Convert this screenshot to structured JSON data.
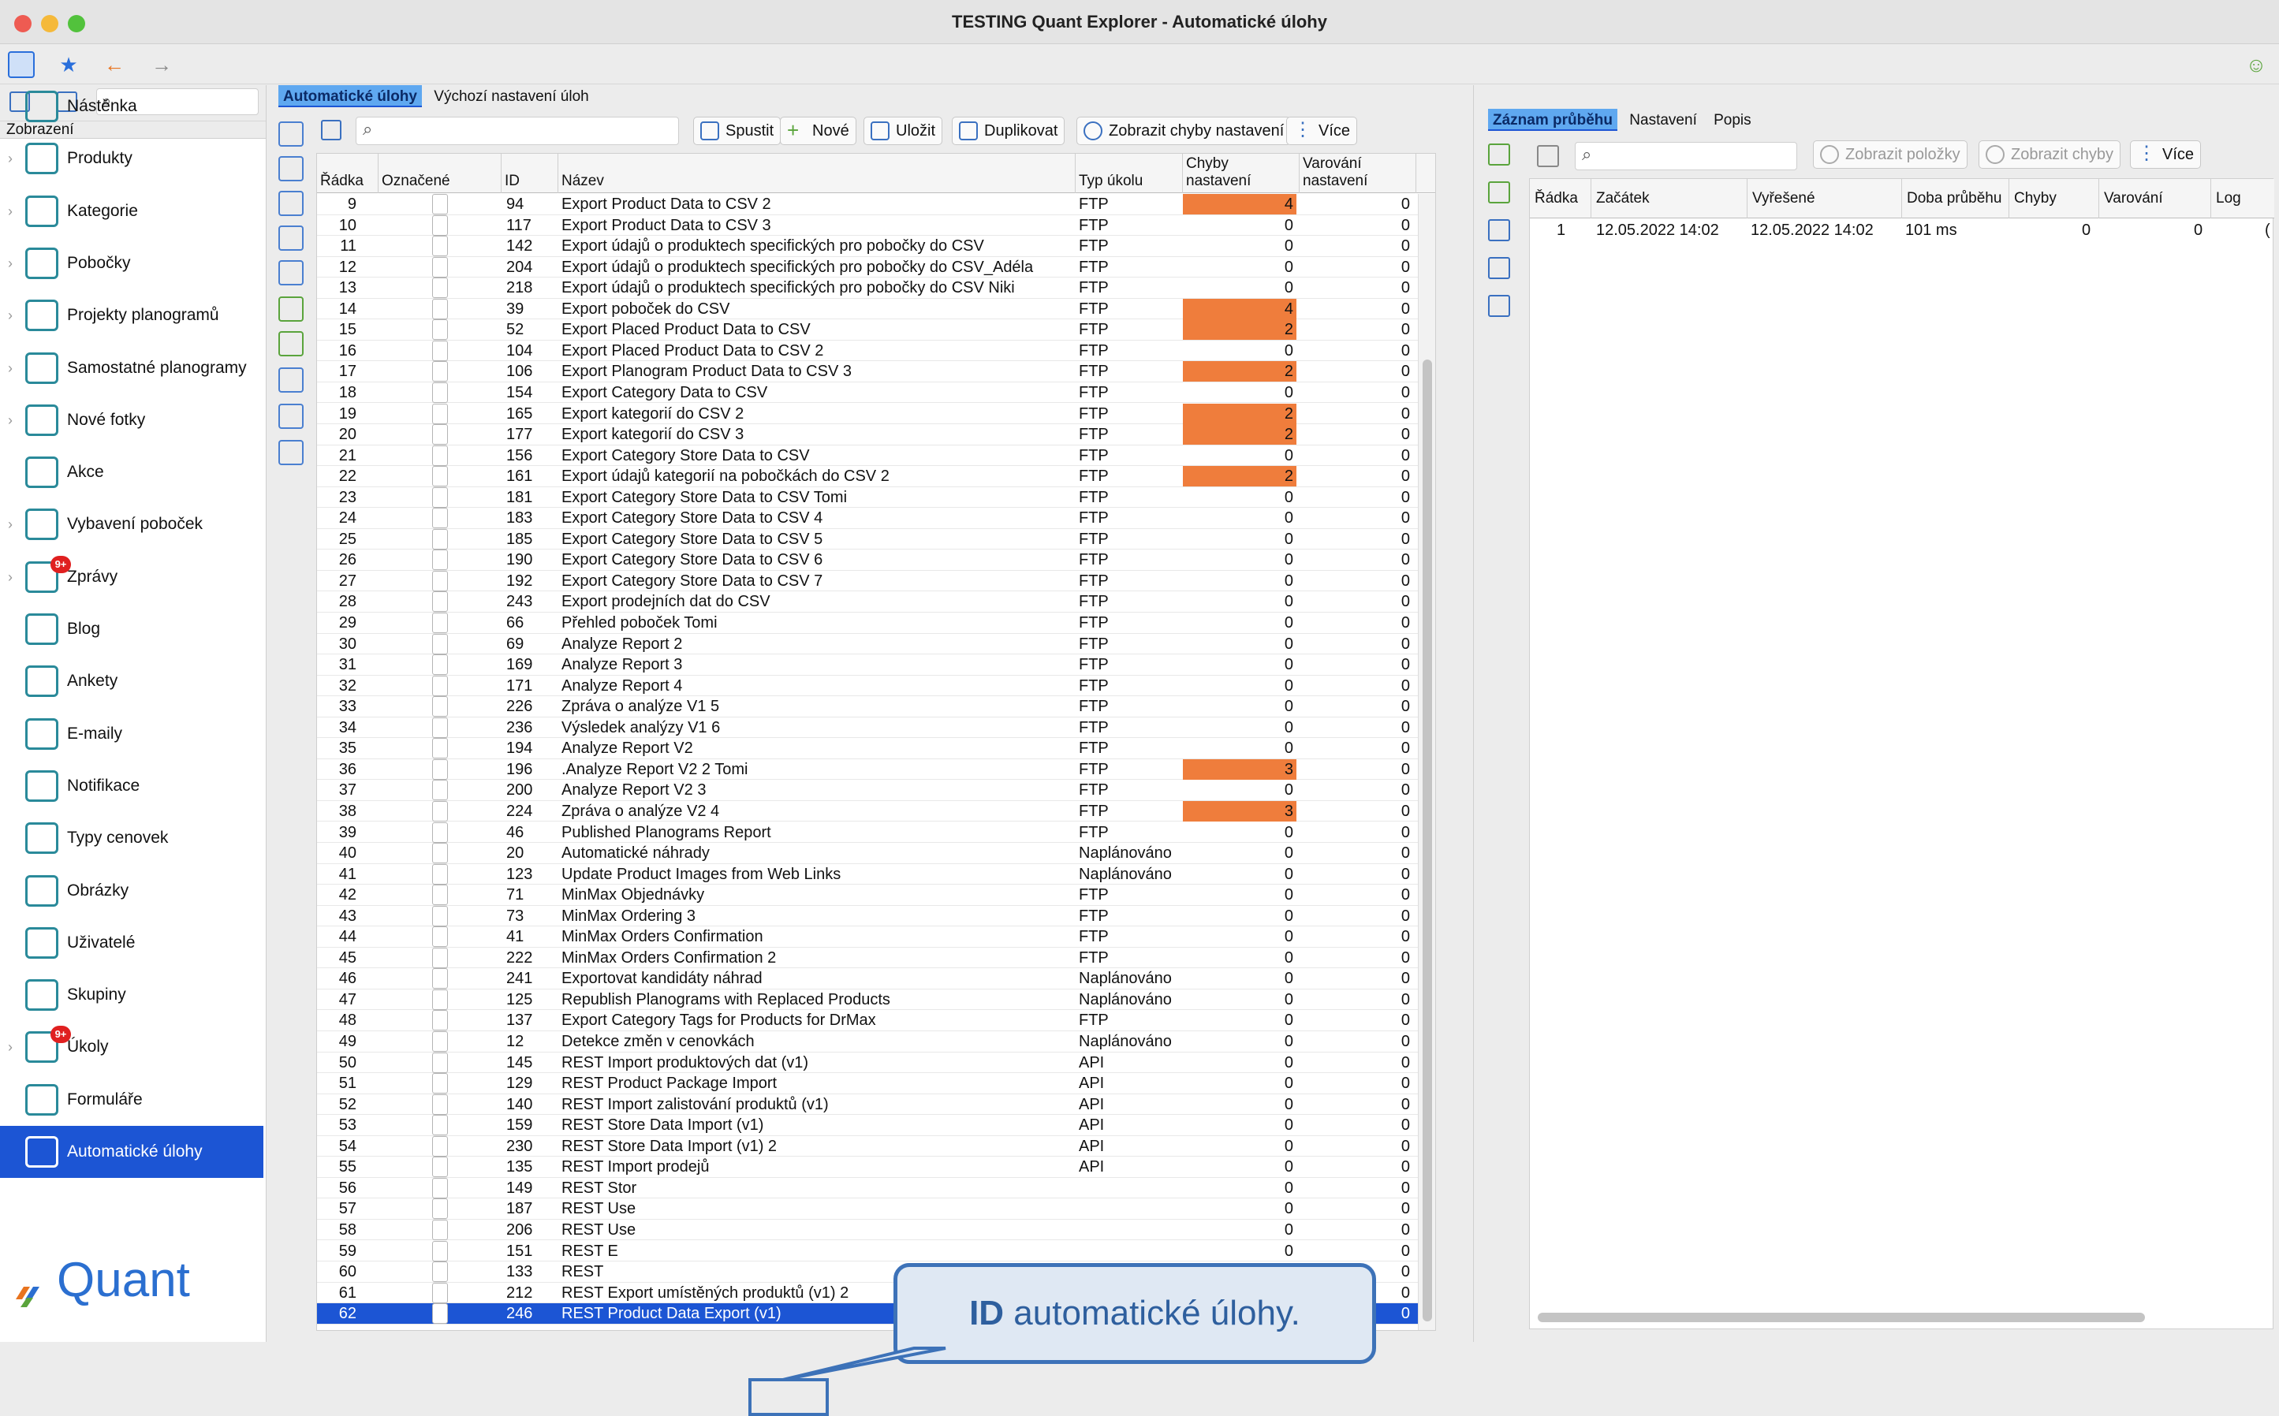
{
  "window": {
    "title": "TESTING Quant Explorer - Automatické úlohy"
  },
  "sidebar": {
    "header": "Zobrazení",
    "items": [
      {
        "label": "Nástěnka",
        "icon": "dashboard-icon",
        "chev": false,
        "badge": ""
      },
      {
        "label": "Produkty",
        "icon": "products-icon",
        "chev": true,
        "badge": ""
      },
      {
        "label": "Kategorie",
        "icon": "categories-icon",
        "chev": true,
        "badge": ""
      },
      {
        "label": "Pobočky",
        "icon": "stores-icon",
        "chev": true,
        "badge": ""
      },
      {
        "label": "Projekty planogramů",
        "icon": "planogram-projects-icon",
        "chev": true,
        "badge": ""
      },
      {
        "label": "Samostatné planogramy",
        "icon": "planograms-icon",
        "chev": true,
        "badge": ""
      },
      {
        "label": "Nové fotky",
        "icon": "camera-icon",
        "chev": true,
        "badge": ""
      },
      {
        "label": "Akce",
        "icon": "promotions-icon",
        "chev": false,
        "badge": ""
      },
      {
        "label": "Vybavení poboček",
        "icon": "equipment-icon",
        "chev": true,
        "badge": ""
      },
      {
        "label": "Zprávy",
        "icon": "messages-icon",
        "chev": true,
        "badge": "9+"
      },
      {
        "label": "Blog",
        "icon": "blog-icon",
        "chev": false,
        "badge": ""
      },
      {
        "label": "Ankety",
        "icon": "surveys-icon",
        "chev": false,
        "badge": ""
      },
      {
        "label": "E-maily",
        "icon": "email-icon",
        "chev": false,
        "badge": ""
      },
      {
        "label": "Notifikace",
        "icon": "notifications-icon",
        "chev": false,
        "badge": ""
      },
      {
        "label": "Typy cenovek",
        "icon": "price-tags-icon",
        "chev": false,
        "badge": ""
      },
      {
        "label": "Obrázky",
        "icon": "images-icon",
        "chev": false,
        "badge": ""
      },
      {
        "label": "Uživatelé",
        "icon": "users-icon",
        "chev": false,
        "badge": ""
      },
      {
        "label": "Skupiny",
        "icon": "groups-icon",
        "chev": false,
        "badge": ""
      },
      {
        "label": "Úkoly",
        "icon": "tasks-icon",
        "chev": true,
        "badge": "9+"
      },
      {
        "label": "Formuláře",
        "icon": "forms-icon",
        "chev": false,
        "badge": ""
      },
      {
        "label": "Automatické úlohy",
        "icon": "automatic-tasks-icon",
        "chev": false,
        "badge": "",
        "active": true
      }
    ],
    "logo": "Quant"
  },
  "center": {
    "tabs": [
      "Automatické úlohy",
      "Výchozí nastavení úloh"
    ],
    "buttons": [
      "Spustit",
      "Nové",
      "Uložit",
      "Duplikovat",
      "Zobrazit chyby nastavení",
      "Více"
    ],
    "columns": [
      "Řádka",
      "Označené",
      "ID",
      "Název",
      "Typ úkolu",
      "Chyby nastavení",
      "Varování nastavení"
    ],
    "rows": [
      [
        "9",
        "94",
        "Export Product Data to CSV 2",
        "FTP",
        "4",
        "0"
      ],
      [
        "10",
        "117",
        "Export Product Data to CSV 3",
        "FTP",
        "0",
        "0"
      ],
      [
        "11",
        "142",
        "Export údajů o produktech specifických pro pobočky do CSV",
        "FTP",
        "0",
        "0"
      ],
      [
        "12",
        "204",
        "Export údajů o produktech specifických pro pobočky do CSV_Adéla",
        "FTP",
        "0",
        "0"
      ],
      [
        "13",
        "218",
        "Export údajů o produktech specifických pro pobočky do CSV Niki",
        "FTP",
        "0",
        "0"
      ],
      [
        "14",
        "39",
        "Export poboček do CSV",
        "FTP",
        "4",
        "0"
      ],
      [
        "15",
        "52",
        "Export Placed Product Data to CSV",
        "FTP",
        "2",
        "0"
      ],
      [
        "16",
        "104",
        "Export Placed Product Data to CSV 2",
        "FTP",
        "0",
        "0"
      ],
      [
        "17",
        "106",
        "Export Planogram Product Data to CSV 3",
        "FTP",
        "2",
        "0"
      ],
      [
        "18",
        "154",
        "Export Category Data to CSV",
        "FTP",
        "0",
        "0"
      ],
      [
        "19",
        "165",
        "Export kategorií do CSV 2",
        "FTP",
        "2",
        "0"
      ],
      [
        "20",
        "177",
        "Export kategorií do CSV 3",
        "FTP",
        "2",
        "0"
      ],
      [
        "21",
        "156",
        "Export Category Store Data to CSV",
        "FTP",
        "0",
        "0"
      ],
      [
        "22",
        "161",
        "Export údajů kategorií na pobočkách do CSV 2",
        "FTP",
        "2",
        "0"
      ],
      [
        "23",
        "181",
        "Export Category Store Data to CSV Tomi",
        "FTP",
        "0",
        "0"
      ],
      [
        "24",
        "183",
        "Export Category Store Data to CSV 4",
        "FTP",
        "0",
        "0"
      ],
      [
        "25",
        "185",
        "Export Category Store Data to CSV 5",
        "FTP",
        "0",
        "0"
      ],
      [
        "26",
        "190",
        "Export Category Store Data to CSV 6",
        "FTP",
        "0",
        "0"
      ],
      [
        "27",
        "192",
        "Export Category Store Data to CSV 7",
        "FTP",
        "0",
        "0"
      ],
      [
        "28",
        "243",
        "Export prodejních dat do CSV",
        "FTP",
        "0",
        "0"
      ],
      [
        "29",
        "66",
        "Přehled poboček Tomi",
        "FTP",
        "0",
        "0"
      ],
      [
        "30",
        "69",
        "Analyze Report 2",
        "FTP",
        "0",
        "0"
      ],
      [
        "31",
        "169",
        "Analyze Report 3",
        "FTP",
        "0",
        "0"
      ],
      [
        "32",
        "171",
        "Analyze Report 4",
        "FTP",
        "0",
        "0"
      ],
      [
        "33",
        "226",
        "Zpráva o analýze V1 5",
        "FTP",
        "0",
        "0"
      ],
      [
        "34",
        "236",
        "Výsledek analýzy V1 6",
        "FTP",
        "0",
        "0"
      ],
      [
        "35",
        "194",
        "Analyze Report V2",
        "FTP",
        "0",
        "0"
      ],
      [
        "36",
        "196",
        ".Analyze Report V2 2 Tomi",
        "FTP",
        "3",
        "0"
      ],
      [
        "37",
        "200",
        "Analyze Report V2 3",
        "FTP",
        "0",
        "0"
      ],
      [
        "38",
        "224",
        "Zpráva o analýze V2 4",
        "FTP",
        "3",
        "0"
      ],
      [
        "39",
        "46",
        "Published Planograms Report",
        "FTP",
        "0",
        "0"
      ],
      [
        "40",
        "20",
        "Automatické náhrady",
        "Naplánováno",
        "0",
        "0"
      ],
      [
        "41",
        "123",
        "Update Product Images from Web Links",
        "Naplánováno",
        "0",
        "0"
      ],
      [
        "42",
        "71",
        "MinMax Objednávky",
        "FTP",
        "0",
        "0"
      ],
      [
        "43",
        "73",
        "MinMax Ordering 3",
        "FTP",
        "0",
        "0"
      ],
      [
        "44",
        "41",
        "MinMax Orders Confirmation",
        "FTP",
        "0",
        "0"
      ],
      [
        "45",
        "222",
        "MinMax Orders Confirmation 2",
        "FTP",
        "0",
        "0"
      ],
      [
        "46",
        "241",
        "Exportovat kandidáty náhrad",
        "Naplánováno",
        "0",
        "0"
      ],
      [
        "47",
        "125",
        "Republish Planograms with Replaced Products",
        "Naplánováno",
        "0",
        "0"
      ],
      [
        "48",
        "137",
        "Export Category Tags for Products for DrMax",
        "FTP",
        "0",
        "0"
      ],
      [
        "49",
        "12",
        "Detekce změn v cenovkách",
        "Naplánováno",
        "0",
        "0"
      ],
      [
        "50",
        "145",
        "REST Import produktových dat (v1)",
        "API",
        "0",
        "0"
      ],
      [
        "51",
        "129",
        "REST Product Package Import",
        "API",
        "0",
        "0"
      ],
      [
        "52",
        "140",
        "REST Import zalistování produktů (v1)",
        "API",
        "0",
        "0"
      ],
      [
        "53",
        "159",
        "REST Store Data Import (v1)",
        "API",
        "0",
        "0"
      ],
      [
        "54",
        "230",
        "REST Store Data Import (v1) 2",
        "API",
        "0",
        "0"
      ],
      [
        "55",
        "135",
        "REST Import prodejů",
        "API",
        "0",
        "0"
      ],
      [
        "56",
        "149",
        "REST Stor",
        "",
        "0",
        "0"
      ],
      [
        "57",
        "187",
        "REST Use",
        "",
        "0",
        "0"
      ],
      [
        "58",
        "206",
        "REST Use",
        "",
        "0",
        "0"
      ],
      [
        "59",
        "151",
        "REST E",
        "",
        "0",
        "0"
      ],
      [
        "60",
        "133",
        "REST",
        "",
        "0",
        "0"
      ],
      [
        "61",
        "212",
        "REST Export umístěných produktů (v1) 2",
        "API",
        "0",
        "0"
      ],
      [
        "62",
        "246",
        "REST Product Data Export (v1)",
        "API",
        "0",
        "0"
      ]
    ]
  },
  "right": {
    "tabs": [
      "Záznam průběhu",
      "Nastavení",
      "Popis"
    ],
    "buttons": [
      "Zobrazit položky",
      "Zobrazit chyby",
      "Více"
    ],
    "columns": [
      "Řádka",
      "Začátek",
      "Vyřešené",
      "Doba průběhu",
      "Chyby",
      "Varování",
      "Log"
    ],
    "rows": [
      [
        "1",
        "12.05.2022 14:02",
        "12.05.2022 14:02",
        "101 ms",
        "0",
        "0",
        "("
      ]
    ]
  },
  "callout": {
    "bold": "ID",
    "text": " automatické úlohy."
  },
  "colors": {
    "accent": "#1c55d4",
    "error_cell": "#ef7d3c",
    "callout_border": "#3d72b8"
  }
}
